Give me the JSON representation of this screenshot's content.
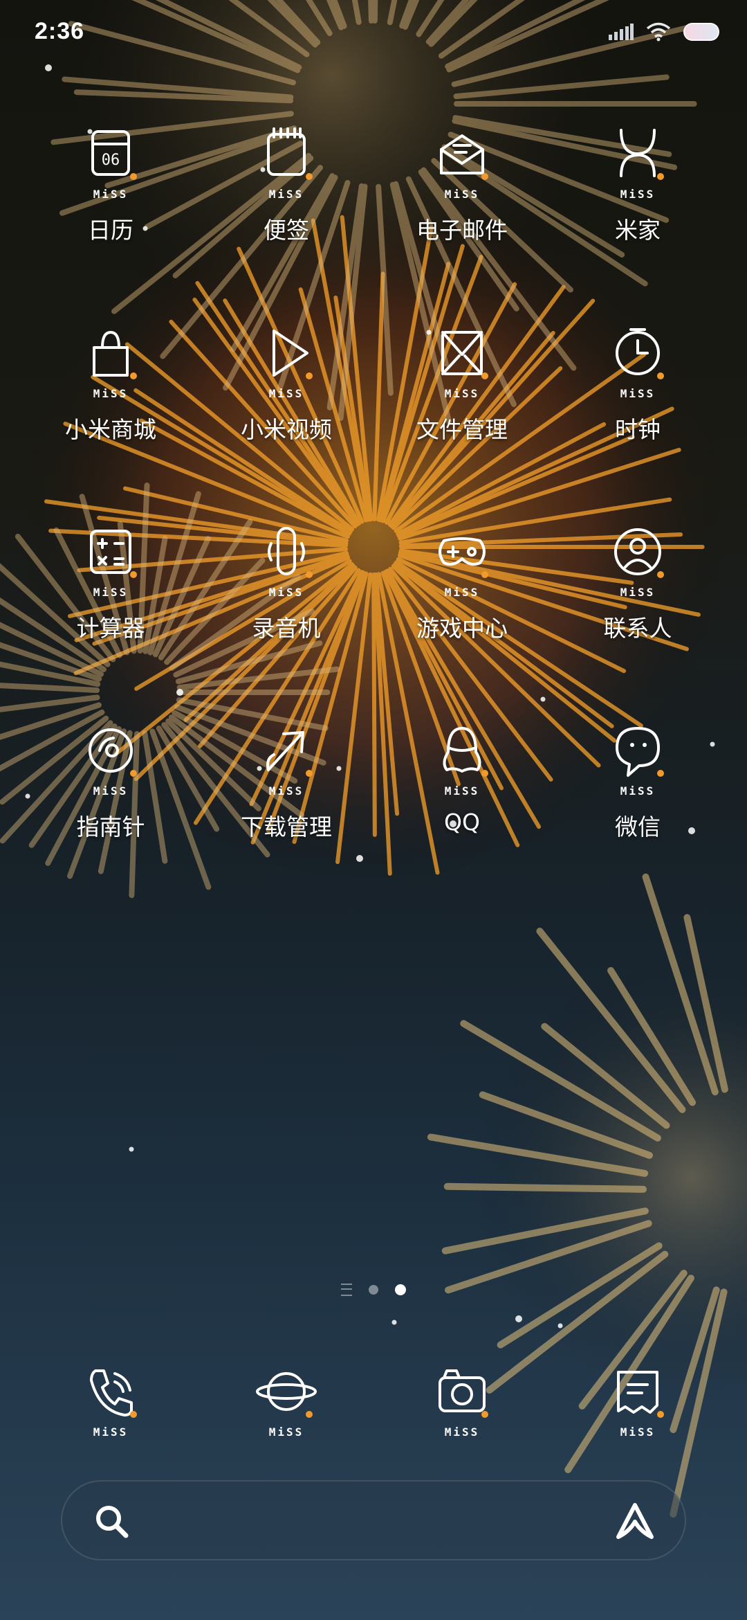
{
  "status_bar": {
    "time": "2:36"
  },
  "apps": [
    {
      "label": "日历",
      "icon": "calendar-icon",
      "date_text": "06",
      "badge": "MiSS"
    },
    {
      "label": "便签",
      "icon": "notes-icon",
      "badge": "MiSS"
    },
    {
      "label": "电子邮件",
      "icon": "email-icon",
      "badge": "MiSS"
    },
    {
      "label": "米家",
      "icon": "mijia-icon",
      "badge": "MiSS"
    },
    {
      "label": "小米商城",
      "icon": "shopping-bag-icon",
      "badge": "MiSS"
    },
    {
      "label": "小米视频",
      "icon": "play-icon",
      "badge": "MiSS"
    },
    {
      "label": "文件管理",
      "icon": "file-envelope-icon",
      "badge": "MiSS"
    },
    {
      "label": "时钟",
      "icon": "clock-icon",
      "badge": "MiSS"
    },
    {
      "label": "计算器",
      "icon": "calculator-icon",
      "badge": "MiSS"
    },
    {
      "label": "录音机",
      "icon": "recorder-icon",
      "badge": "MiSS"
    },
    {
      "label": "游戏中心",
      "icon": "gamepad-icon",
      "badge": "MiSS"
    },
    {
      "label": "联系人",
      "icon": "contact-icon",
      "badge": "MiSS"
    },
    {
      "label": "指南针",
      "icon": "compass-icon",
      "badge": "MiSS"
    },
    {
      "label": "下载管理",
      "icon": "download-arrow-icon",
      "badge": "MiSS"
    },
    {
      "label": "QQ",
      "icon": "qq-penguin-icon",
      "badge": "MiSS"
    },
    {
      "label": "微信",
      "icon": "wechat-bubble-icon",
      "badge": "MiSS"
    }
  ],
  "pager": {
    "pages": 2,
    "active_index": 1
  },
  "dock": [
    {
      "icon": "phone-icon",
      "badge": "MiSS"
    },
    {
      "icon": "browser-planet-icon",
      "badge": "MiSS"
    },
    {
      "icon": "camera-icon",
      "badge": "MiSS"
    },
    {
      "icon": "messages-icon",
      "badge": "MiSS"
    }
  ],
  "search": {
    "left_icon": "search-icon",
    "right_icon": "assistant-icon"
  },
  "colors": {
    "accent_dot": "#f29a2c",
    "icon_stroke": "#ffffff"
  }
}
